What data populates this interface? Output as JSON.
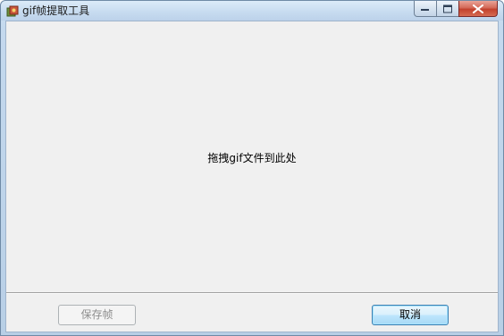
{
  "window": {
    "title": "gif帧提取工具",
    "icon": "app-icon"
  },
  "caption_buttons": {
    "minimize_icon": "minimize-icon",
    "maximize_icon": "maximize-icon",
    "close_icon": "close-icon"
  },
  "main": {
    "drop_hint": "拖拽gif文件到此处"
  },
  "footer": {
    "save_label": "保存帧",
    "cancel_label": "取消"
  },
  "colors": {
    "titlebar": "#c8dcf0",
    "client_background": "#f0f0f0",
    "close_button": "#c2412d",
    "default_button_border": "#3c7fb1",
    "disabled_text": "#8d8d8d"
  }
}
